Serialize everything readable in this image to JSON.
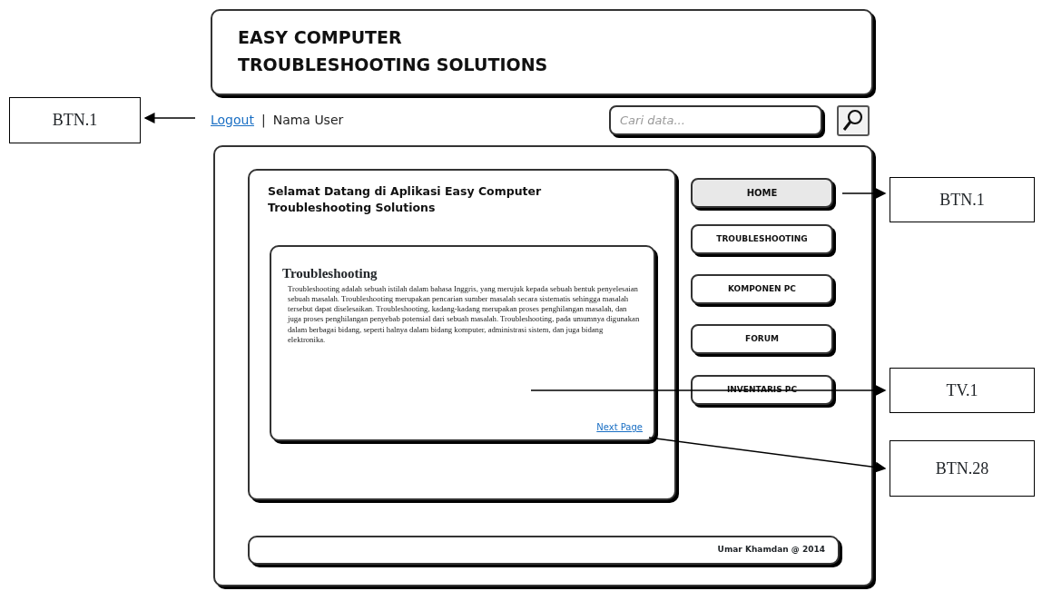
{
  "header": {
    "title_lines": [
      "EASY COMPUTER",
      "TROUBLESHOOTING SOLUTIONS"
    ]
  },
  "user_bar": {
    "logout_link": "Logout",
    "separator": "|",
    "user_name": "Nama User"
  },
  "search": {
    "placeholder": "Cari data..."
  },
  "welcome": {
    "heading": "Selamat Datang di Aplikasi Easy Computer Troubleshooting Solutions"
  },
  "article": {
    "title": "Troubleshooting",
    "body": "Troubleshooting adalah sebuah istilah dalam bahasa Inggris, yang merujuk kepada sebuah bentuk penyelesaian sebuah masalah. Troubleshooting merupakan pencarian sumber masalah secara sistematis sehingga masalah tersebut dapat diselesaikan. Troubleshooting, kadang-kadang merupakan proses penghilangan masalah, dan juga proses penghilangan penyebab potensial dari sebuah masalah. Troubleshooting, pada umumnya digunakan dalam berbagai bidang, seperti halnya dalam bidang komputer, administrasi sistem, dan juga bidang elektronika.",
    "next_link": "Next Page"
  },
  "menu": [
    {
      "label": "HOME",
      "selected": true
    },
    {
      "label": "TROUBLESHOOTING",
      "selected": false
    },
    {
      "label": "KOMPONEN PC",
      "selected": false
    },
    {
      "label": "FORUM",
      "selected": false
    },
    {
      "label": "INVENTARIS PC",
      "selected": false
    }
  ],
  "footer": {
    "text": "Umar Khamdan @ 2014"
  },
  "annotations": [
    {
      "label": "BTN.1"
    },
    {
      "label": "BTN.1"
    },
    {
      "label": "TV.1"
    },
    {
      "label": "BTN.28"
    }
  ]
}
